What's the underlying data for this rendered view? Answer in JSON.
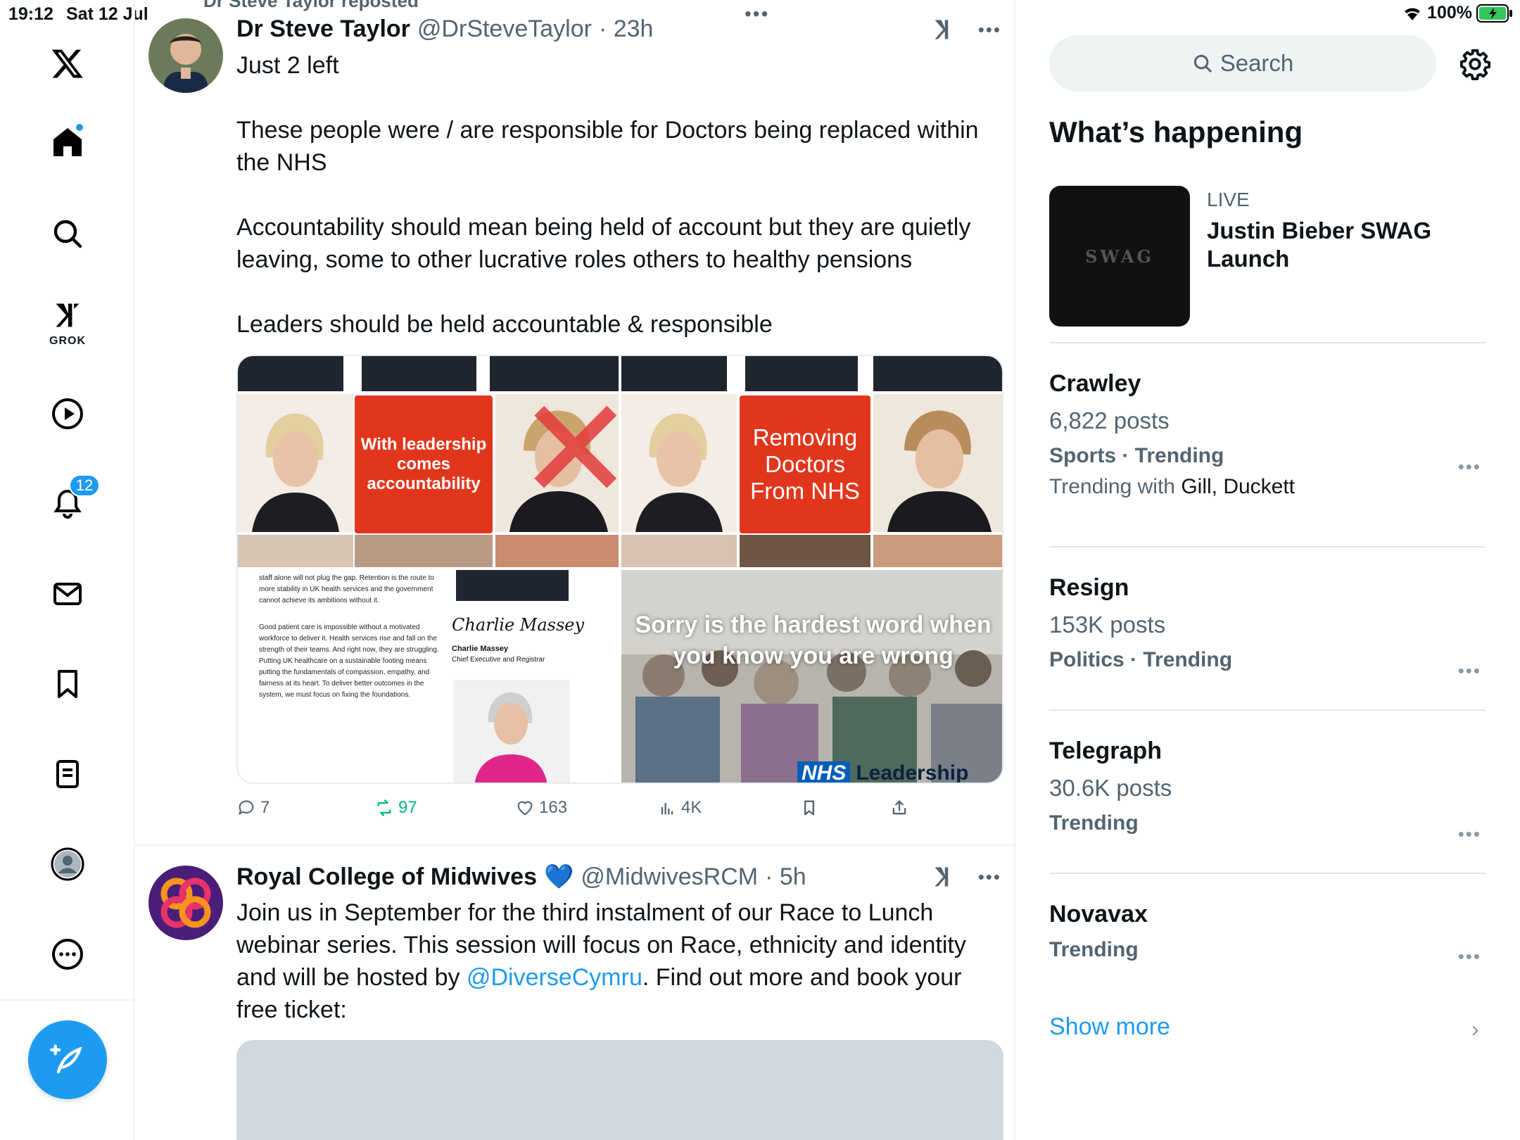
{
  "status_bar": {
    "time": "19:12",
    "date": "Sat 12 Jul",
    "battery": "100%"
  },
  "nav": {
    "grok_label": "GROK",
    "notifications_count": "12"
  },
  "feed": {
    "repost_label": "Dr Steve Taylor reposted",
    "tweets": [
      {
        "name": "Dr Steve Taylor",
        "handle": "@DrSteveTaylor",
        "time": "· 23h",
        "paragraphs": [
          "Just 2 left",
          "These people were / are responsible for Doctors being replaced within the NHS",
          "Accountability should mean being held of account but they are quietly leaving, some to other lucrative roles others to healthy pensions",
          "Leaders should be held accountable & responsible"
        ],
        "media": {
          "q1_box": "With leadership comes accountability",
          "q2_box": "Removing Doctors From NHS",
          "letter_text_1": "staff alone will not plug the gap. Retention is the route to more stability in UK health services and the government cannot achieve its ambitions without it.",
          "letter_text_2": "Good patient care is impossible without a motivated workforce to deliver it. Health services rise and fall on the strength of their teams. And right now, they are struggling. Putting UK healthcare on a sustainable footing means putting the fundamentals of compassion, empathy, and fairness at its heart. To deliver better outcomes in the system, we must focus on fixing the foundations.",
          "signature": "Charlie Massey",
          "sig_name": "Charlie Massey",
          "sig_title": "Chief Executive and Registrar",
          "q4_text": "Sorry is the hardest word when you know you are wrong",
          "nhs_logo": "NHS",
          "nhs_text": "Leadership"
        },
        "actions": {
          "replies": "7",
          "reposts": "97",
          "likes": "163",
          "views": "4K"
        }
      },
      {
        "name": "Royal College of Midwives",
        "verified_emoji": "💙",
        "handle": "@MidwivesRCM",
        "time": "· 5h",
        "body_before_link": "Join us in September for the third instalment of our Race to Lunch webinar series. This session will focus on Race, ethnicity and identity and will be hosted by ",
        "link": "@DiverseCymru",
        "body_after_link": ". Find out more and book your free ticket:"
      }
    ]
  },
  "sidebar": {
    "search_placeholder": "Search",
    "whats_happening": "What’s happening",
    "live": {
      "tag": "LIVE",
      "title": "Justin Bieber SWAG Launch",
      "image_text": "SWAG"
    },
    "trends": [
      {
        "name": "Crawley",
        "count": "6,822 posts",
        "category": "Sports · Trending",
        "with_label": "Trending with ",
        "with_names": "Gill, Duckett"
      },
      {
        "name": "Resign",
        "count": "153K posts",
        "category": "Politics · Trending"
      },
      {
        "name": "Telegraph",
        "count": "30.6K posts",
        "category": "Trending"
      },
      {
        "name": "Novavax",
        "category": "Trending"
      }
    ],
    "show_more": "Show more"
  },
  "colors": {
    "accent": "#1d9bf0",
    "repost_green": "#00ba7c",
    "nhs_red_box": "#e2361c"
  }
}
